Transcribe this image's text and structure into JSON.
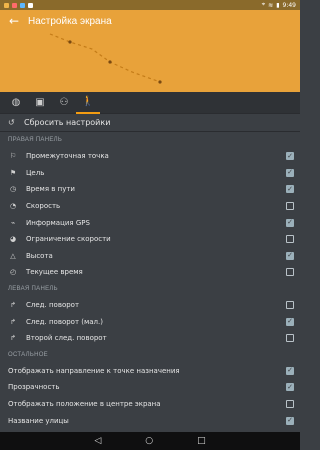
{
  "status": {
    "time": "9:49"
  },
  "header": {
    "title": "Настройка экрана"
  },
  "tabs": [
    {
      "icon": "globe-icon"
    },
    {
      "icon": "car-icon"
    },
    {
      "icon": "bicycle-icon"
    },
    {
      "icon": "pedestrian-icon",
      "active": true
    }
  ],
  "reset": {
    "label": "Сбросить настройки"
  },
  "sections": {
    "right": {
      "title": "ПРАВАЯ ПАНЕЛЬ",
      "items": [
        {
          "label": "Промежуточная точка",
          "checked": true,
          "icon": "flag-small-icon"
        },
        {
          "label": "Цель",
          "checked": true,
          "icon": "flag-icon"
        },
        {
          "label": "Время в пути",
          "checked": true,
          "icon": "clock-icon"
        },
        {
          "label": "Скорость",
          "checked": false,
          "icon": "speedometer-icon"
        },
        {
          "label": "Информация GPS",
          "checked": true,
          "icon": "gps-icon"
        },
        {
          "label": "Ограничение скорости",
          "checked": false,
          "icon": "speed-limit-icon"
        },
        {
          "label": "Высота",
          "checked": true,
          "icon": "mountain-icon"
        },
        {
          "label": "Текущее время",
          "checked": false,
          "icon": "time-icon"
        }
      ]
    },
    "left": {
      "title": "ЛЕВАЯ ПАНЕЛЬ",
      "items": [
        {
          "label": "След. поворот",
          "checked": false,
          "icon": "turn-icon"
        },
        {
          "label": "След. поворот (мал.)",
          "checked": true,
          "icon": "turn-small-icon"
        },
        {
          "label": "Второй след. поворот",
          "checked": false,
          "icon": "turn-second-icon"
        }
      ]
    },
    "other": {
      "title": "ОСТАЛЬНОЕ",
      "items": [
        {
          "label": "Отображать направление к точке назначения",
          "checked": true
        },
        {
          "label": "Прозрачность",
          "checked": true
        },
        {
          "label": "Отображать положение в центре экрана",
          "checked": false
        },
        {
          "label": "Название улицы",
          "checked": true
        }
      ]
    }
  }
}
